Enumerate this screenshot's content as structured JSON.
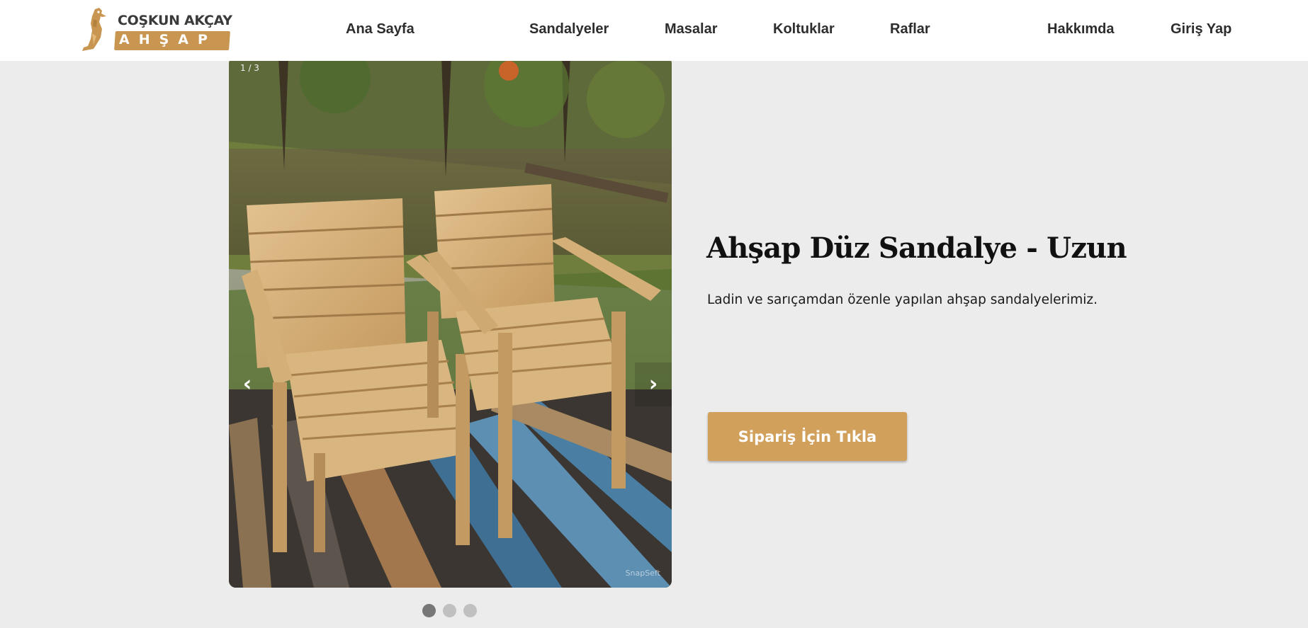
{
  "brand": {
    "line1": "COŞKUN AKÇAY",
    "line2": "AHŞAP",
    "icon": "woodpecker-logo-icon",
    "accent_color": "#c99651"
  },
  "nav": {
    "home": "Ana Sayfa",
    "chairs": "Sandalyeler",
    "tables": "Masalar",
    "armchairs": "Koltuklar",
    "shelves": "Raflar",
    "about": "Hakkımda",
    "login": "Giriş Yap"
  },
  "slider": {
    "counter": "1 / 3",
    "prev_icon": "‹",
    "next_icon": "›",
    "watermark": "SnapSeft",
    "image_subject": "wooden-armchairs-photo",
    "total_slides": 3,
    "active_slide": 1
  },
  "product": {
    "title": "Ahşap Düz Sandalye - Uzun",
    "description": "Ladin ve sarıçamdan özenle yapılan ahşap sandalyelerimiz.",
    "order_button": "Sipariş İçin Tıkla",
    "button_color": "#d1a05b"
  }
}
